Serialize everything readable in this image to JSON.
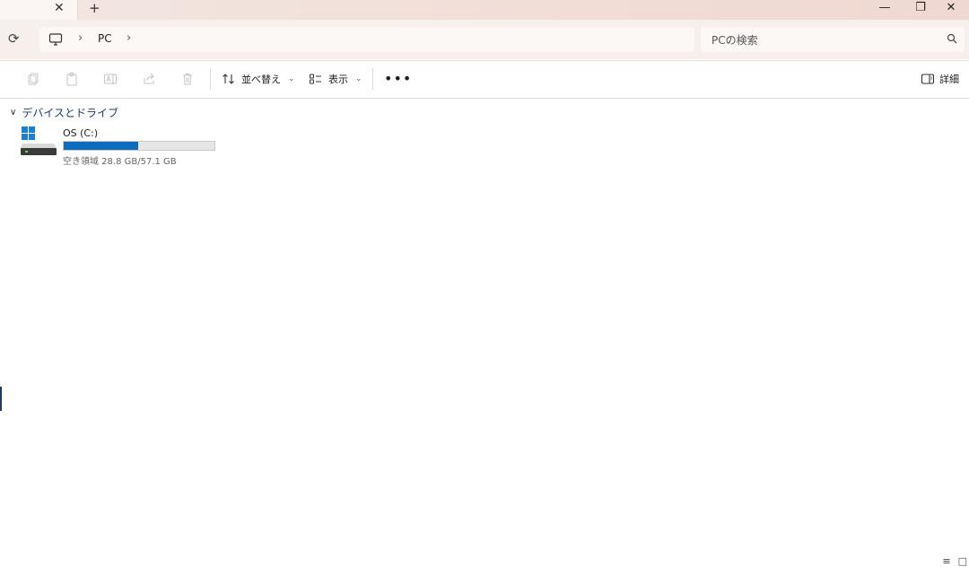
{
  "tabs": {
    "close_glyph": "✕",
    "new_tab_glyph": "+"
  },
  "window": {
    "minimize": "—",
    "maximize": "❐",
    "close": "✕"
  },
  "nav": {
    "refresh_icon": "refresh-icon",
    "breadcrumb": [
      "PC"
    ],
    "separator": "›",
    "search_placeholder": "PCの検索"
  },
  "toolbar": {
    "sort_label": "並べ替え",
    "view_label": "表示",
    "more_label": "•••",
    "details_label": "詳細"
  },
  "group": {
    "title": "デバイスとドライブ"
  },
  "drives": [
    {
      "name": "OS (C:)",
      "free_text": "空き領域 28.8 GB/57.1 GB",
      "used_fraction": 0.4956,
      "bar_color": "#0f6cbd"
    }
  ]
}
